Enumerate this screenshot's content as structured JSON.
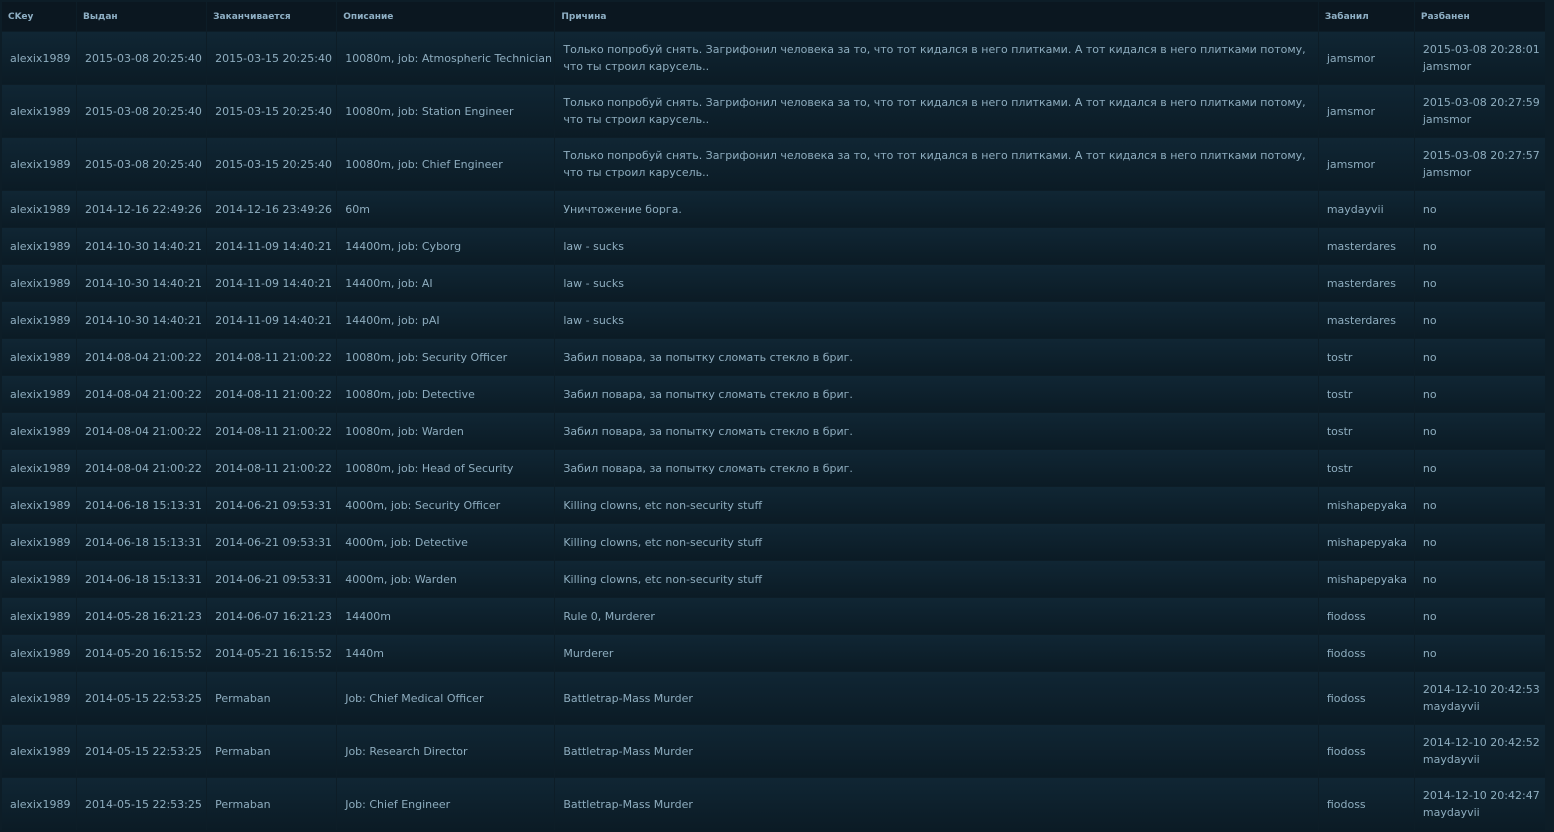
{
  "headers": {
    "ckey": "CKey",
    "issued": "Выдан",
    "expires": "Заканчивается",
    "description": "Описание",
    "reason": "Причина",
    "banned_by": "Забанил",
    "unbanned": "Разбанен"
  },
  "rows": [
    {
      "ckey": "alexix1989",
      "issued": "2015-03-08 20:25:40",
      "expires": "2015-03-15 20:25:40",
      "description": "10080m, job: Atmospheric Technician",
      "reason": "Только попробуй снять. Загрифонил человека за то, что тот кидался в него плитками. А тот кидался в него плитками потому, что ты строил карусель..",
      "banned_by": "jamsmor",
      "unbanned": "2015-03-08 20:28:01",
      "unbanned_by": "jamsmor"
    },
    {
      "ckey": "alexix1989",
      "issued": "2015-03-08 20:25:40",
      "expires": "2015-03-15 20:25:40",
      "description": "10080m, job: Station Engineer",
      "reason": "Только попробуй снять. Загрифонил человека за то, что тот кидался в него плитками. А тот кидался в него плитками потому, что ты строил карусель..",
      "banned_by": "jamsmor",
      "unbanned": "2015-03-08 20:27:59",
      "unbanned_by": "jamsmor"
    },
    {
      "ckey": "alexix1989",
      "issued": "2015-03-08 20:25:40",
      "expires": "2015-03-15 20:25:40",
      "description": "10080m, job: Chief Engineer",
      "reason": "Только попробуй снять. Загрифонил человека за то, что тот кидался в него плитками. А тот кидался в него плитками потому, что ты строил карусель..",
      "banned_by": "jamsmor",
      "unbanned": "2015-03-08 20:27:57",
      "unbanned_by": "jamsmor"
    },
    {
      "ckey": "alexix1989",
      "issued": "2014-12-16 22:49:26",
      "expires": "2014-12-16 23:49:26",
      "description": "60m",
      "reason": "Уничтожение борга.",
      "banned_by": "maydayvii",
      "unbanned": "no",
      "unbanned_by": ""
    },
    {
      "ckey": "alexix1989",
      "issued": "2014-10-30 14:40:21",
      "expires": "2014-11-09 14:40:21",
      "description": "14400m, job: Cyborg",
      "reason": "law - sucks",
      "banned_by": "masterdares",
      "unbanned": "no",
      "unbanned_by": ""
    },
    {
      "ckey": "alexix1989",
      "issued": "2014-10-30 14:40:21",
      "expires": "2014-11-09 14:40:21",
      "description": "14400m, job: AI",
      "reason": "law - sucks",
      "banned_by": "masterdares",
      "unbanned": "no",
      "unbanned_by": ""
    },
    {
      "ckey": "alexix1989",
      "issued": "2014-10-30 14:40:21",
      "expires": "2014-11-09 14:40:21",
      "description": "14400m, job: pAI",
      "reason": "law - sucks",
      "banned_by": "masterdares",
      "unbanned": "no",
      "unbanned_by": ""
    },
    {
      "ckey": "alexix1989",
      "issued": "2014-08-04 21:00:22",
      "expires": "2014-08-11 21:00:22",
      "description": "10080m, job: Security Officer",
      "reason": "Забил повара, за попытку сломать стекло в бриг.",
      "banned_by": "tostr",
      "unbanned": "no",
      "unbanned_by": ""
    },
    {
      "ckey": "alexix1989",
      "issued": "2014-08-04 21:00:22",
      "expires": "2014-08-11 21:00:22",
      "description": "10080m, job: Detective",
      "reason": "Забил повара, за попытку сломать стекло в бриг.",
      "banned_by": "tostr",
      "unbanned": "no",
      "unbanned_by": ""
    },
    {
      "ckey": "alexix1989",
      "issued": "2014-08-04 21:00:22",
      "expires": "2014-08-11 21:00:22",
      "description": "10080m, job: Warden",
      "reason": "Забил повара, за попытку сломать стекло в бриг.",
      "banned_by": "tostr",
      "unbanned": "no",
      "unbanned_by": ""
    },
    {
      "ckey": "alexix1989",
      "issued": "2014-08-04 21:00:22",
      "expires": "2014-08-11 21:00:22",
      "description": "10080m, job: Head of Security",
      "reason": "Забил повара, за попытку сломать стекло в бриг.",
      "banned_by": "tostr",
      "unbanned": "no",
      "unbanned_by": ""
    },
    {
      "ckey": "alexix1989",
      "issued": "2014-06-18 15:13:31",
      "expires": "2014-06-21 09:53:31",
      "description": "4000m, job: Security Officer",
      "reason": "Killing clowns, etc non-security stuff",
      "banned_by": "mishapepyaka",
      "unbanned": "no",
      "unbanned_by": ""
    },
    {
      "ckey": "alexix1989",
      "issued": "2014-06-18 15:13:31",
      "expires": "2014-06-21 09:53:31",
      "description": "4000m, job: Detective",
      "reason": "Killing clowns, etc non-security stuff",
      "banned_by": "mishapepyaka",
      "unbanned": "no",
      "unbanned_by": ""
    },
    {
      "ckey": "alexix1989",
      "issued": "2014-06-18 15:13:31",
      "expires": "2014-06-21 09:53:31",
      "description": "4000m, job: Warden",
      "reason": "Killing clowns, etc non-security stuff",
      "banned_by": "mishapepyaka",
      "unbanned": "no",
      "unbanned_by": ""
    },
    {
      "ckey": "alexix1989",
      "issued": "2014-05-28 16:21:23",
      "expires": "2014-06-07 16:21:23",
      "description": "14400m",
      "reason": "Rule 0, Murderer",
      "banned_by": "fiodoss",
      "unbanned": "no",
      "unbanned_by": ""
    },
    {
      "ckey": "alexix1989",
      "issued": "2014-05-20 16:15:52",
      "expires": "2014-05-21 16:15:52",
      "description": "1440m",
      "reason": "Murderer",
      "banned_by": "fiodoss",
      "unbanned": "no",
      "unbanned_by": ""
    },
    {
      "ckey": "alexix1989",
      "issued": "2014-05-15 22:53:25",
      "expires": "Permaban",
      "description": "Job: Chief Medical Officer",
      "reason": "Battletrap-Mass Murder",
      "banned_by": "fiodoss",
      "unbanned": "2014-12-10 20:42:53",
      "unbanned_by": "maydayvii"
    },
    {
      "ckey": "alexix1989",
      "issued": "2014-05-15 22:53:25",
      "expires": "Permaban",
      "description": "Job: Research Director",
      "reason": "Battletrap-Mass Murder",
      "banned_by": "fiodoss",
      "unbanned": "2014-12-10 20:42:52",
      "unbanned_by": "maydayvii"
    },
    {
      "ckey": "alexix1989",
      "issued": "2014-05-15 22:53:25",
      "expires": "Permaban",
      "description": "Job: Chief Engineer",
      "reason": "Battletrap-Mass Murder",
      "banned_by": "fiodoss",
      "unbanned": "2014-12-10 20:42:47",
      "unbanned_by": "maydayvii"
    }
  ]
}
